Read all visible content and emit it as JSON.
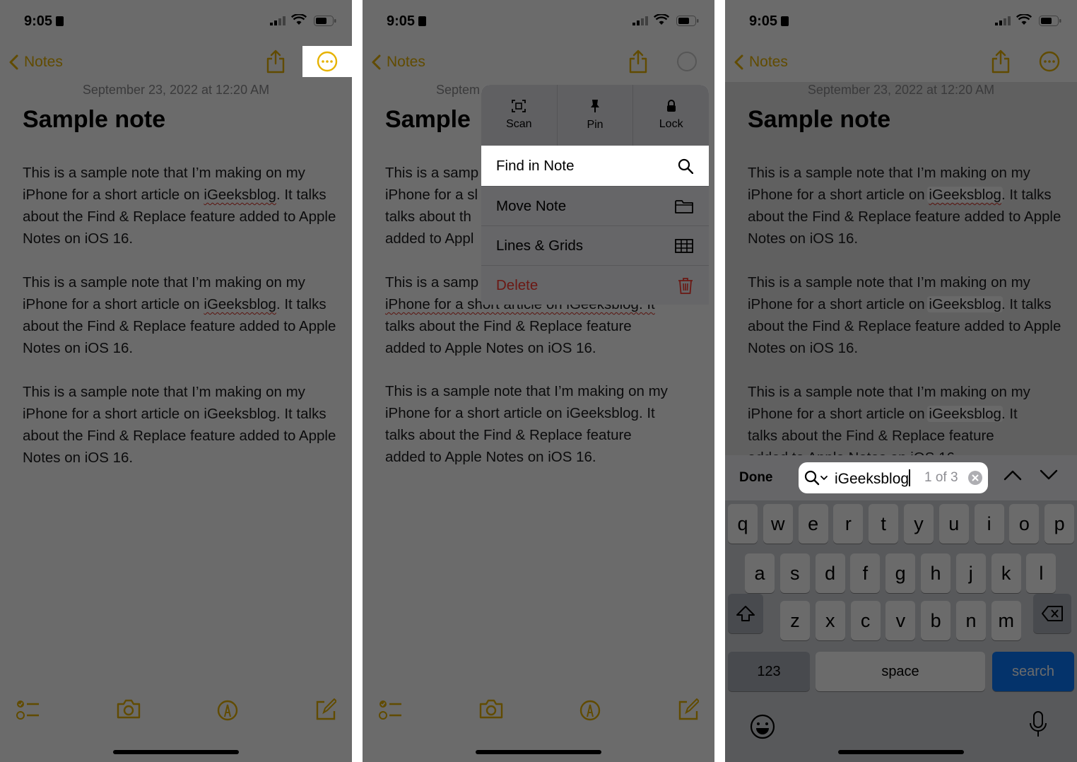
{
  "status": {
    "time": "9:05"
  },
  "nav": {
    "back_label": "Notes"
  },
  "note": {
    "date": "September 23, 2022 at 12:20 AM",
    "title": "Sample note",
    "title_truncated": "Sample",
    "date_truncated": "Septem",
    "para_start": "This is a sample note that I’m making on my iPhone for a short article on ",
    "keyword": "iGeeksblog",
    "para_end": ". It talks about the Find & Replace feature added to Apple Notes on iOS 16.",
    "partial": {
      "l1": "This is a samp",
      "l2": "iPhone for a sl",
      "l3": "talks about th",
      "l4": "added to Appl",
      "p2l1": "This is a samp",
      "p2l2": "iPhone for a short article on iGeeksblog. It",
      "p2l3": "talks about the Find & Replace feature",
      "p2l4": "added to Apple Notes on iOS 16.",
      "p3l1": "This is a sample note that I’m making on my",
      "p3l2": "iPhone for a short article on iGeeksblog. It",
      "p3l3": "talks about the Find & Replace feature",
      "p3l4": "added to Apple Notes on iOS 16."
    },
    "p3": {
      "l1": "This is a sample note that I’m making on my",
      "l2a": "iPhone for a short article on ",
      "l2c": ". It",
      "l3": "talks about the Find & Replace feature",
      "l4": "added to Apple Notes on iOS 16."
    }
  },
  "menu": {
    "top": [
      "Scan",
      "Pin",
      "Lock"
    ],
    "find": "Find in Note",
    "move": "Move Note",
    "lines": "Lines & Grids",
    "delete": "Delete"
  },
  "findbar": {
    "done": "Done",
    "query": "iGeeksblog",
    "count": "1 of 3"
  },
  "keyboard": {
    "row1": [
      "q",
      "w",
      "e",
      "r",
      "t",
      "y",
      "u",
      "i",
      "o",
      "p"
    ],
    "row2": [
      "a",
      "s",
      "d",
      "f",
      "g",
      "h",
      "j",
      "k",
      "l"
    ],
    "row3": [
      "z",
      "x",
      "c",
      "v",
      "b",
      "n",
      "m"
    ],
    "num": "123",
    "space": "space",
    "search": "search"
  },
  "colors": {
    "accent": "#e6b200",
    "delete": "#ff3b30",
    "search_key": "#0a7aff"
  }
}
